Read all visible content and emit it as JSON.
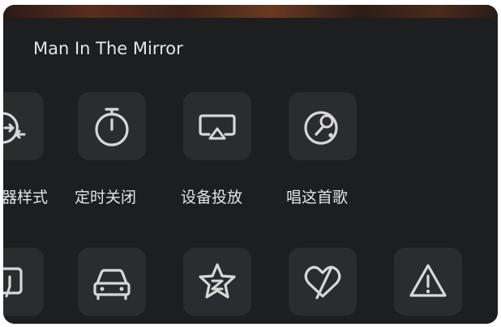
{
  "song": {
    "title": "Man In The Mirror"
  },
  "menu": {
    "row1": [
      {
        "label": "器样式",
        "icon": "player-style-icon"
      },
      {
        "label": "定时关闭",
        "icon": "timer-icon"
      },
      {
        "label": "设备投放",
        "icon": "cast-icon"
      },
      {
        "label": "唱这首歌",
        "icon": "karaoke-icon"
      }
    ],
    "row2": [
      {
        "icon": "lyrics-display-icon"
      },
      {
        "icon": "car-icon"
      },
      {
        "icon": "qq-star-icon"
      },
      {
        "icon": "heart-slash-icon"
      },
      {
        "icon": "warning-icon"
      }
    ]
  }
}
